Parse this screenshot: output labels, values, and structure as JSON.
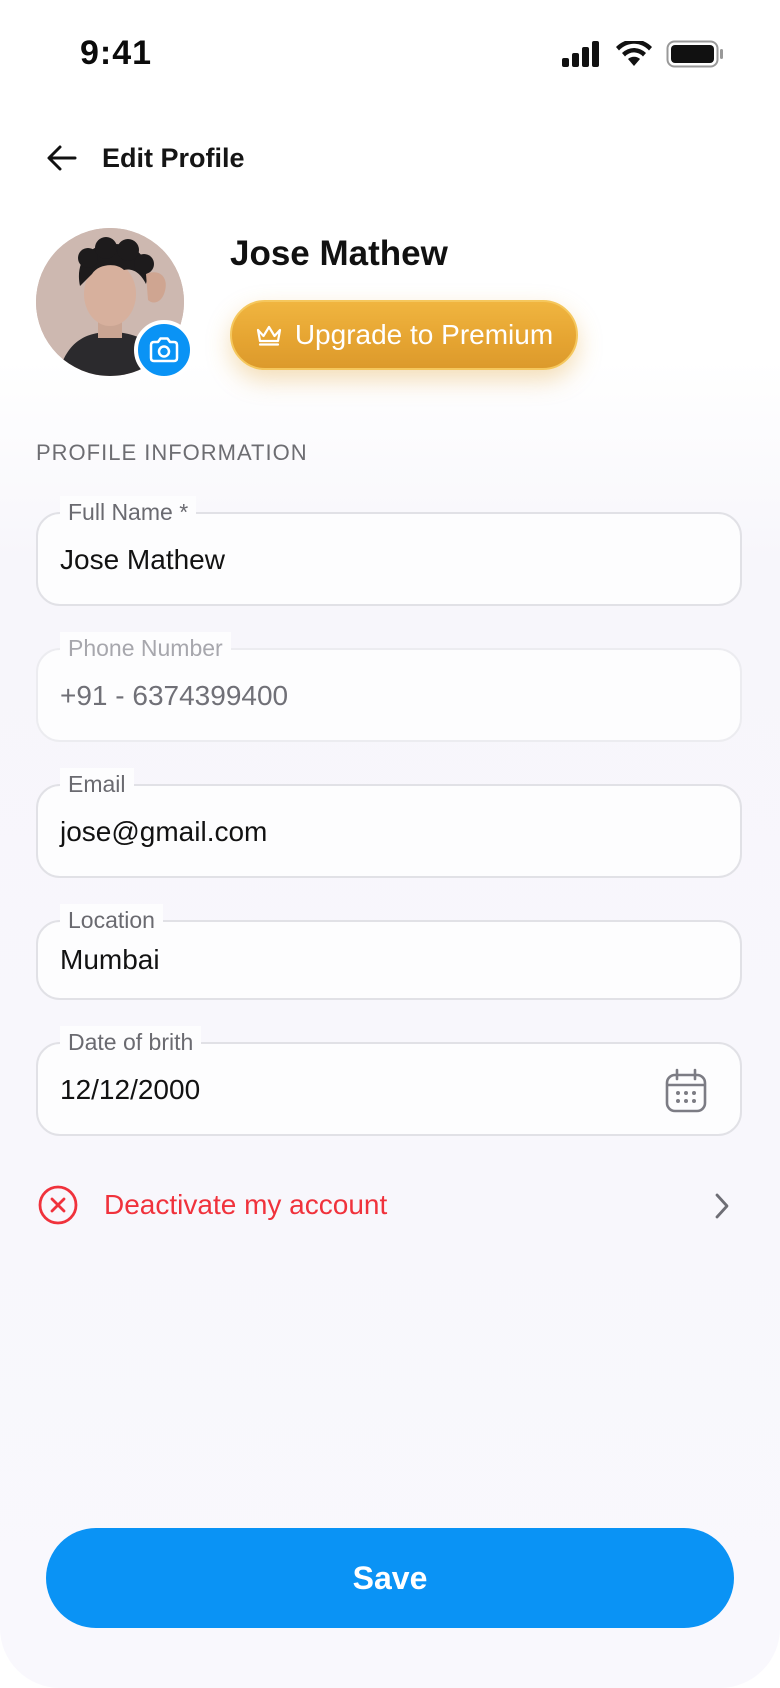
{
  "status_bar": {
    "time": "9:41"
  },
  "header": {
    "title": "Edit Profile"
  },
  "profile": {
    "name": "Jose Mathew",
    "premium_label": "Upgrade to Premium"
  },
  "section": {
    "title": "PROFILE  INFORMATION"
  },
  "fields": {
    "full_name": {
      "label": "Full Name *",
      "value": "Jose Mathew"
    },
    "phone": {
      "label": "Phone Number",
      "value": "+91 - 6374399400"
    },
    "email": {
      "label": "Email",
      "value": "jose@gmail.com"
    },
    "location": {
      "label": "Location",
      "value": "Mumbai"
    },
    "dob": {
      "label": "Date of brith",
      "value": "12/12/2000"
    }
  },
  "deactivate": {
    "label": "Deactivate my account"
  },
  "save": {
    "label": "Save"
  },
  "colors": {
    "primary": "#0a93f5",
    "premium_gold": "#e6a532",
    "danger": "#f0323c"
  },
  "icons": [
    "signal-icon",
    "wifi-icon",
    "battery-icon",
    "back-arrow-icon",
    "camera-icon",
    "crown-icon",
    "calendar-icon",
    "close-circle-icon",
    "chevron-right-icon"
  ]
}
